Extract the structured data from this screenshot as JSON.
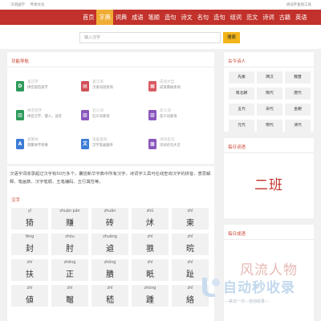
{
  "header": {
    "site_name": "汉语国学",
    "slogan": "传承文化",
    "right_title": "诗词字查询工具"
  },
  "nav": [
    "首页",
    "字典",
    "词典",
    "成语",
    "笔顺",
    "造句",
    "诗文",
    "名句",
    "造句",
    "组词",
    "范文",
    "诗词",
    "古籍",
    "英语"
  ],
  "search": {
    "placeholder": "输入汉字",
    "button": "搜索"
  },
  "functions": {
    "title": "功能导航",
    "items": [
      {
        "title": "查汉字",
        "desc": "拼音部首查字",
        "icon": "D",
        "color": "#2e9a5b"
      },
      {
        "title": "查汉语",
        "desc": "汉语词语查询",
        "icon": "▤",
        "color": "#d24f5a"
      },
      {
        "title": "成语大全",
        "desc": "成语典故查询",
        "icon": "▦",
        "color": "#d95b62"
      },
      {
        "title": "拼音检字",
        "desc": "拼音汉字、键入、读音",
        "icon": "▥",
        "color": "#2e9a5b"
      },
      {
        "title": "近义词",
        "desc": "近义词查询",
        "icon": "▧",
        "color": "#8a57bd"
      },
      {
        "title": "反义词",
        "desc": "反义词查询",
        "icon": "▨",
        "color": "#8a57bd"
      },
      {
        "title": "查繁体",
        "desc": "简繁体字转换",
        "icon": "A",
        "color": "#3b7cd6"
      },
      {
        "title": "笔画查询",
        "desc": "汉字笔画顺序",
        "icon": "文",
        "color": "#3b7cd6"
      },
      {
        "title": "诗词名句",
        "desc": "诗词名句大全",
        "icon": "▩",
        "color": "#8a57bd"
      }
    ]
  },
  "intro": "汉语字词收录超过汉字有50万多个，囊括新华字典中所有汉字。诗词字工具可在线查询汉字的拼音、意思解释、笔画数、汉字笔顺、五笔编码、五行属性等。",
  "hanzi": {
    "title": "汉字",
    "cells": [
      {
        "py": "yǐ",
        "ch": "猗"
      },
      {
        "py": "zhuàn pán",
        "ch": "赚"
      },
      {
        "py": "zhuǎn",
        "ch": "砖"
      },
      {
        "py": "zhǔ",
        "ch": "炢"
      },
      {
        "py": "zhī",
        "ch": "柬"
      },
      {
        "py": "fēng",
        "ch": "封"
      },
      {
        "py": "zhǒu",
        "ch": "肘"
      },
      {
        "py": "zhuāng",
        "ch": "逌"
      },
      {
        "py": "zhī",
        "ch": "翐"
      },
      {
        "py": "zhǐ",
        "ch": "晥"
      },
      {
        "py": "zhí",
        "ch": "扶"
      },
      {
        "py": "zhēng",
        "ch": "正"
      },
      {
        "py": "zhǒng",
        "ch": "膭"
      },
      {
        "py": "zhī",
        "ch": "眂"
      },
      {
        "py": "zhǐ",
        "ch": "趾"
      },
      {
        "py": "zhí",
        "ch": "値"
      },
      {
        "py": "zhī",
        "ch": "鼅"
      },
      {
        "py": "zhǐ",
        "ch": "嵇"
      },
      {
        "py": "zhòng",
        "ch": "踵"
      },
      {
        "py": "zhǐ",
        "ch": "絡"
      }
    ]
  },
  "poets": {
    "title": "古今诗人",
    "names": [
      "先秦",
      "两汉",
      "魏晋",
      "南北朝",
      "隋代",
      "唐代",
      "五代",
      "宋代",
      "金朝",
      "元代",
      "明代",
      "清代"
    ]
  },
  "daily_word": {
    "title": "每日词语",
    "word": "二班"
  },
  "daily_idiom": {
    "title": "每日成语",
    "word": "风流人物"
  },
  "watermark": {
    "brand": "自动秒收录",
    "sub": "—来访一次—自动收录—"
  }
}
